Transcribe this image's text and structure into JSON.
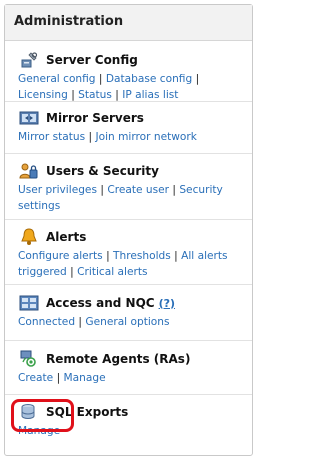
{
  "panel": {
    "title": "Administration"
  },
  "sections": [
    {
      "title": "Server Config",
      "icon": "server-config-icon",
      "links": [
        "General config",
        "Database config",
        "Licensing",
        "Status",
        "IP alias list"
      ]
    },
    {
      "title": "Mirror Servers",
      "icon": "mirror-servers-icon",
      "links": [
        "Mirror status",
        "Join mirror network"
      ]
    },
    {
      "title": "Users & Security",
      "icon": "users-security-icon",
      "links": [
        "User privileges",
        "Create user",
        "Security settings"
      ]
    },
    {
      "title": "Alerts",
      "icon": "alert-bell-icon",
      "links": [
        "Configure alerts",
        "Thresholds",
        "All alerts triggered",
        "Critical alerts"
      ]
    },
    {
      "title": "Access and NQC",
      "help": "(?)",
      "icon": "access-grid-icon",
      "links": [
        "Connected",
        "General options"
      ]
    },
    {
      "title": "Remote Agents (RAs)",
      "icon": "remote-agent-icon",
      "links": [
        "Create",
        "Manage"
      ]
    },
    {
      "title": "SQL Exports",
      "icon": "database-icon",
      "links": [
        "Manage"
      ]
    }
  ],
  "separator": "|",
  "colors": {
    "link": "#2a6fb8",
    "highlight": "#e0101a"
  }
}
